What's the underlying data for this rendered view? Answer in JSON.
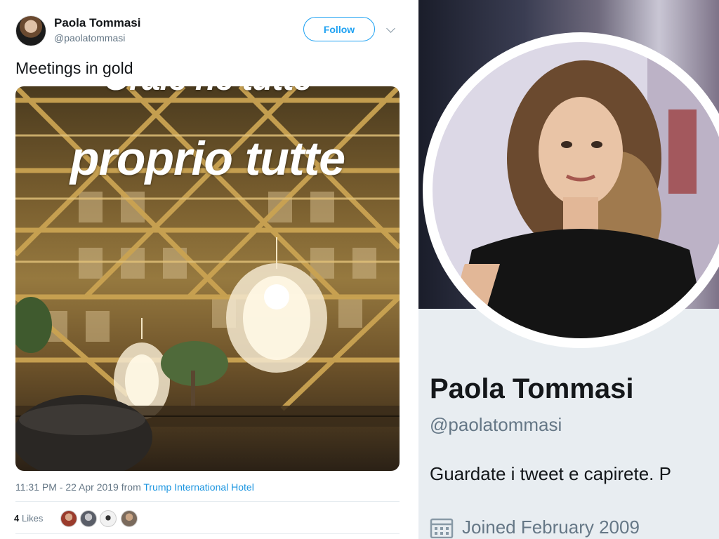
{
  "tweet": {
    "author": {
      "name": "Paola Tommasi",
      "handle": "@paolatommasi"
    },
    "follow_label": "Follow",
    "text": "Meetings in gold",
    "media_overlay": {
      "line1": "Oraie ne tutte",
      "line2": "proprio tutte"
    },
    "meta": {
      "timestamp": "11:31 PM - 22 Apr 2019",
      "from_word": "from",
      "place": "Trump International Hotel"
    },
    "likes": {
      "count": "4",
      "label": "Likes"
    },
    "colors": {
      "accent": "#1da1f2",
      "link": "#1b95e0",
      "muted": "#657786",
      "text": "#14171a"
    }
  },
  "profile": {
    "name": "Paola Tommasi",
    "handle": "@paolatommasi",
    "bio": "Guardate i tweet e capirete. P",
    "joined": "Joined February 2009",
    "icon": "calendar-icon",
    "colors": {
      "panel": "#e8edf1"
    }
  }
}
